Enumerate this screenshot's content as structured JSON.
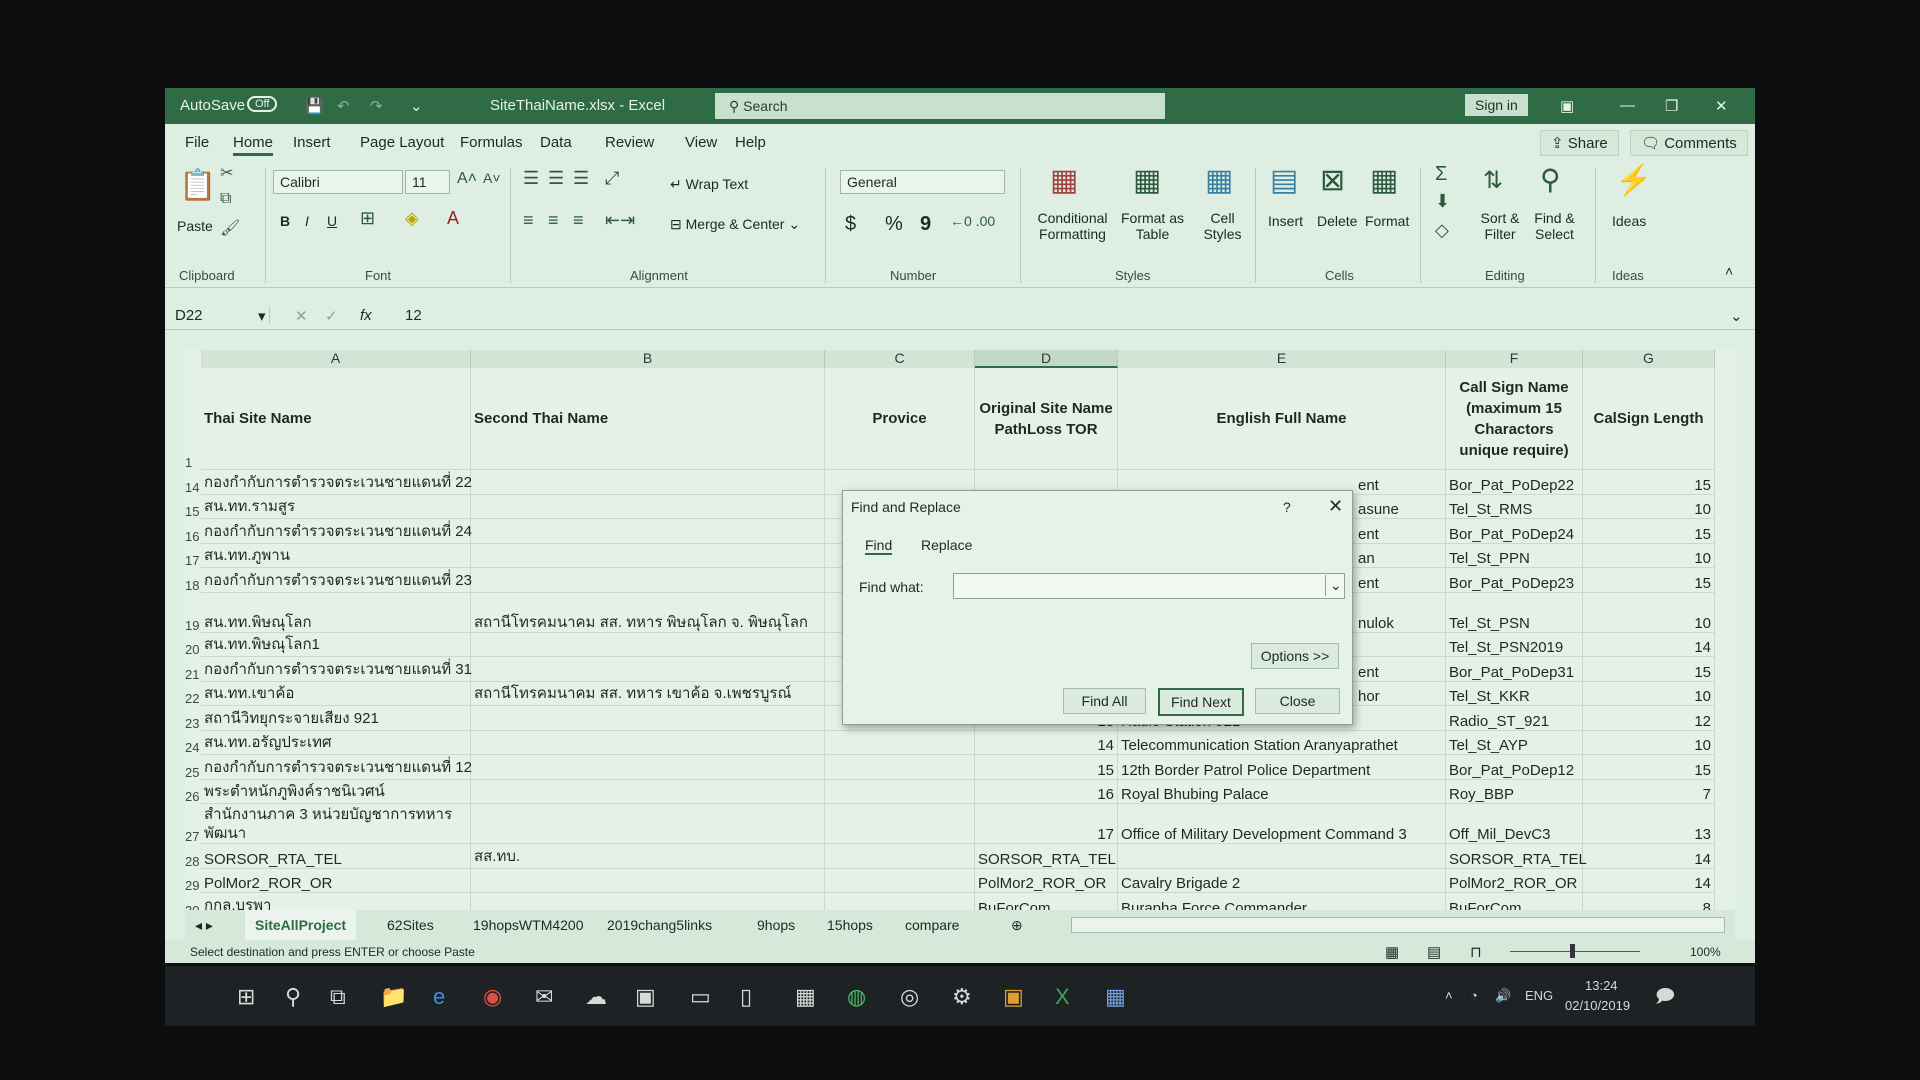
{
  "window": {
    "autosave_label": "AutoSave",
    "autosave_state": "Off",
    "title": "SiteThaiName.xlsx  -  Excel",
    "search_placeholder": "Search",
    "sign_in": "Sign in"
  },
  "ribbon_tabs": [
    "File",
    "Home",
    "Insert",
    "Page Layout",
    "Formulas",
    "Data",
    "Review",
    "View",
    "Help"
  ],
  "active_tab": "Home",
  "share": "Share",
  "comments": "Comments",
  "ribbon": {
    "clipboard": {
      "paste": "Paste",
      "group": "Clipboard"
    },
    "font": {
      "name": "Calibri",
      "size": "11",
      "bold": "B",
      "italic": "I",
      "underline": "U",
      "group": "Font"
    },
    "alignment": {
      "wrap_text": "Wrap Text",
      "merge_center": "Merge & Center",
      "group": "Alignment"
    },
    "number": {
      "format": "General",
      "currency": "$",
      "percent": "%",
      "comma": "9",
      "group": "Number"
    },
    "styles": {
      "conditional": "Conditional Formatting",
      "format_table": "Format as Table",
      "cell_styles": "Cell Styles",
      "group": "Styles"
    },
    "cells": {
      "insert": "Insert",
      "delete": "Delete",
      "format": "Format",
      "group": "Cells"
    },
    "editing": {
      "sort_filter": "Sort & Filter",
      "find_select": "Find & Select",
      "group": "Editing"
    },
    "ideas": {
      "ideas": "Ideas",
      "group": "Ideas"
    }
  },
  "formula_bar": {
    "name_box": "D22",
    "fx": "fx",
    "value": "12"
  },
  "columns": [
    "A",
    "B",
    "C",
    "D",
    "E",
    "F",
    "G"
  ],
  "selected_column": "D",
  "headers": {
    "row": "1",
    "A": "Thai Site Name",
    "B": "Second Thai Name",
    "C": "Provice",
    "D": "Original Site Name PathLoss TOR",
    "E": "English Full Name",
    "F": "Call Sign Name (maximum 15 Charactors unique require)",
    "G": "CalSign Length"
  },
  "rows": [
    {
      "n": "14",
      "A": "กองกำกับการตำรวจตระเวนชายแดนที่ 22",
      "B": "",
      "D": "",
      "E": "ent",
      "F": "Bor_Pat_PoDep22",
      "G": "15"
    },
    {
      "n": "15",
      "A": "สน.ทท.รามสูร",
      "B": "",
      "D": "",
      "E": "asune",
      "F": "Tel_St_RMS",
      "G": "10"
    },
    {
      "n": "16",
      "A": "กองกำกับการตำรวจตระเวนชายแดนที่ 24",
      "B": "",
      "D": "",
      "E": "ent",
      "F": "Bor_Pat_PoDep24",
      "G": "15"
    },
    {
      "n": "17",
      "A": "สน.ทท.ภูพาน",
      "B": "",
      "D": "",
      "E": "an",
      "F": "Tel_St_PPN",
      "G": "10"
    },
    {
      "n": "18",
      "A": "กองกำกับการตำรวจตระเวนชายแดนที่ 23",
      "B": "",
      "D": "",
      "E": "ent",
      "F": "Bor_Pat_PoDep23",
      "G": "15"
    },
    {
      "n": "19",
      "A": "สน.ทท.พิษณุโลก",
      "B": "สถานีโทรคมนาคม สส. ทหาร พิษณุโลก จ. พิษณุโลก",
      "D": "",
      "E": "nulok",
      "F": "Tel_St_PSN",
      "G": "10",
      "tall": true
    },
    {
      "n": "20",
      "A": "สน.ทท.พิษณุโลก1",
      "B": "",
      "D": "",
      "E": "",
      "F": "Tel_St_PSN2019",
      "G": "14"
    },
    {
      "n": "21",
      "A": "กองกำกับการตำรวจตระเวนชายแดนที่ 31",
      "B": "",
      "D": "",
      "E": "ent",
      "F": "Bor_Pat_PoDep31",
      "G": "15"
    },
    {
      "n": "22",
      "A": "สน.ทท.เขาค้อ",
      "B": "สถานีโทรคมนาคม สส. ทหาร เขาค้อ จ.เพชรบูรณ์",
      "D": "",
      "E": "hor",
      "F": "Tel_St_KKR",
      "G": "10"
    },
    {
      "n": "23",
      "A": "สถานีวิทยุกระจายเสียง 921",
      "B": "",
      "D": "13",
      "E": "Radio Station 921",
      "F": "Radio_ST_921",
      "G": "12"
    },
    {
      "n": "24",
      "A": "สน.ทท.อรัญประเทศ",
      "B": "",
      "D": "14",
      "E": "Telecommunication Station Aranyaprathet",
      "F": "Tel_St_AYP",
      "G": "10"
    },
    {
      "n": "25",
      "A": "กองกำกับการตำรวจตระเวนชายแดนที่ 12",
      "B": "",
      "D": "15",
      "E": "12th Border Patrol Police Department",
      "F": "Bor_Pat_PoDep12",
      "G": "15"
    },
    {
      "n": "26",
      "A": "พระตำหนักภูพิงค์ราชนิเวศน์",
      "B": "",
      "D": "16",
      "E": "Royal Bhubing  Palace",
      "F": "Roy_BBP",
      "G": "7"
    },
    {
      "n": "27",
      "A": "สำนักงานภาค 3 หน่วยบัญชาการทหารพัฒนา",
      "B": "",
      "D": "17",
      "E": "Office of Military Development Command 3",
      "F": "Off_Mil_DevC3",
      "G": "13",
      "tall": true
    },
    {
      "n": "28",
      "A": "SORSOR_RTA_TEL",
      "B": "สส.ทบ.",
      "D": "SORSOR_RTA_TEL",
      "E": "",
      "F": "SORSOR_RTA_TEL",
      "G": "14"
    },
    {
      "n": "29",
      "A": "PolMor2_ROR_OR",
      "B": "",
      "D": "PolMor2_ROR_OR",
      "E": "Cavalry Brigade 2",
      "F": "PolMor2_ROR_OR",
      "G": "14"
    },
    {
      "n": "30",
      "A": "กกล.บูรพา",
      "B": "",
      "D": "BuForCom",
      "E": "Burapha Force Commander",
      "F": "BuForCom",
      "G": "8"
    }
  ],
  "dialog": {
    "title": "Find and Replace",
    "help": "?",
    "tabs": [
      "Find",
      "Replace"
    ],
    "find_label": "Find what:",
    "find_value": "",
    "options": "Options >>",
    "find_all": "Find All",
    "find_next": "Find Next",
    "close": "Close"
  },
  "sheet_tabs": [
    "SiteAllProject",
    "62Sites",
    "19hopsWTM4200",
    "2019chang5links",
    "9hops",
    "15hops",
    "compare"
  ],
  "active_sheet": "SiteAllProject",
  "status": {
    "message": "Select destination and press ENTER or choose Paste",
    "zoom": "100%"
  },
  "taskbar": {
    "language": "ENG",
    "time": "13:24",
    "date": "02/10/2019"
  },
  "colors": {
    "title_green": "#2f6b45",
    "sheet_bg": "#e3f1e6"
  }
}
